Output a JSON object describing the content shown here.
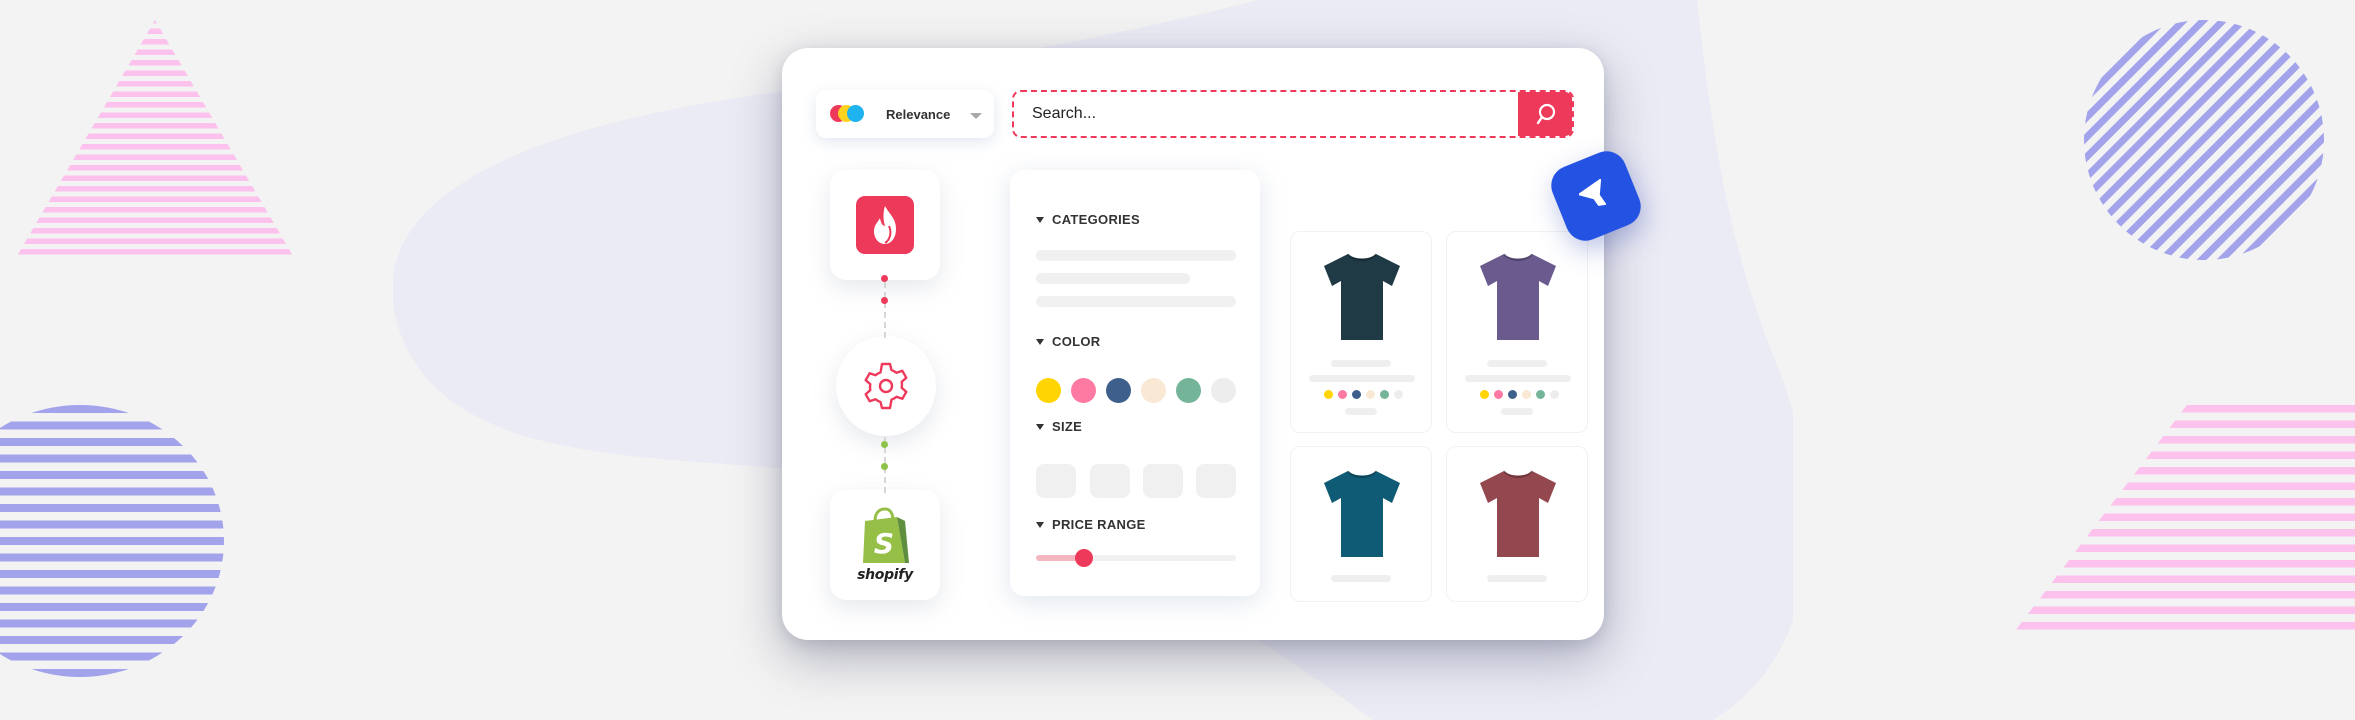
{
  "colors": {
    "accent": "#ee3a5a",
    "badge_blue": "#2453e4",
    "shopify_green": "#95bf47"
  },
  "brand_logo": {
    "icon": "overlapping-circles-logo",
    "dot_colors": [
      "#ee3a5a",
      "#ffd21f",
      "#1fb4ef"
    ]
  },
  "sort": {
    "selected": "Relevance",
    "icon": "chevron-down-icon"
  },
  "search": {
    "placeholder": "Search...",
    "value": "",
    "button_icon": "search-icon"
  },
  "integrations": [
    {
      "name": "fire-app",
      "icon": "flame-icon"
    },
    {
      "name": "settings",
      "icon": "gear-icon"
    },
    {
      "name": "shopify",
      "icon": "shopify-bag-icon",
      "label": "shopify"
    }
  ],
  "filters": {
    "categories": {
      "label": "CATEGORIES"
    },
    "color": {
      "label": "COLOR",
      "swatches": [
        "#ffd400",
        "#ff7aa2",
        "#3e5e8c",
        "#f9e8d3",
        "#74b59a",
        "#ededed"
      ]
    },
    "size": {
      "label": "SIZE",
      "option_count": 4
    },
    "price_range": {
      "label": "PRICE RANGE",
      "value_fraction": 0.24
    }
  },
  "products": [
    {
      "name": "dark-teal-tshirt",
      "color": "#1f3a45",
      "show_swatches": true
    },
    {
      "name": "purple-tshirt",
      "color": "#6a5a8e",
      "show_swatches": true
    },
    {
      "name": "blue-tshirt",
      "color": "#0f5a74",
      "show_swatches": false
    },
    {
      "name": "maroon-tshirt",
      "color": "#93474f",
      "show_swatches": false
    }
  ],
  "product_swatches": [
    "#ffd400",
    "#ff7aa2",
    "#3e5e8c",
    "#f9e8d3",
    "#74b59a",
    "#ededed"
  ],
  "floating_badge": {
    "icon": "filter-funnel-icon"
  }
}
